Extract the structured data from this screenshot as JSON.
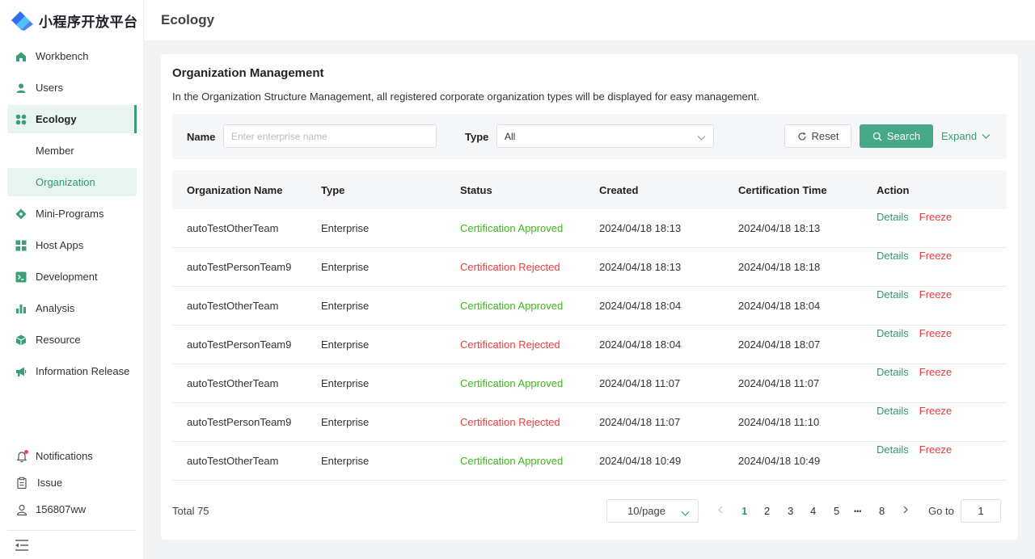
{
  "app": {
    "name": "小程序开放平台"
  },
  "colors": {
    "brand_blue": "#2e6ff2",
    "accent_green": "#46a985",
    "approved": "#3fb51f",
    "rejected": "#ef3c3c"
  },
  "sidebar": {
    "items": [
      {
        "label": "Workbench",
        "icon": "home-icon"
      },
      {
        "label": "Users",
        "icon": "user-icon"
      },
      {
        "label": "Ecology",
        "icon": "grid-icon",
        "active": true
      },
      {
        "label": "Member",
        "sub": true
      },
      {
        "label": "Organization",
        "sub": true,
        "active": true
      },
      {
        "label": "Mini-Programs",
        "icon": "diamond-icon"
      },
      {
        "label": "Host Apps",
        "icon": "apps-icon"
      },
      {
        "label": "Development",
        "icon": "terminal-icon"
      },
      {
        "label": "Analysis",
        "icon": "bar-chart-icon"
      },
      {
        "label": "Resource",
        "icon": "cube-icon"
      },
      {
        "label": "Information Release",
        "icon": "megaphone-icon"
      }
    ],
    "bottom": [
      {
        "label": "Notifications",
        "icon": "bell-icon",
        "has_dot": true
      },
      {
        "label": "Issue",
        "icon": "clipboard-icon"
      },
      {
        "label": "156807ww",
        "icon": "profile-icon"
      }
    ]
  },
  "header": {
    "title": "Ecology"
  },
  "card": {
    "title": "Organization Management",
    "description": "In the Organization Structure Management, all registered corporate organization types will be displayed for easy management."
  },
  "filter": {
    "name_label": "Name",
    "name_placeholder": "Enter enterprise name",
    "name_value": "",
    "type_label": "Type",
    "type_value": "All",
    "reset_label": "Reset",
    "search_label": "Search",
    "expand_label": "Expand"
  },
  "table": {
    "columns": [
      "Organization Name",
      "Type",
      "Status",
      "Created",
      "Certification Time",
      "Action"
    ],
    "rows": [
      {
        "name": "autoTestOtherTeam",
        "type": "Enterprise",
        "status": "Certification Approved",
        "status_kind": "approved",
        "created": "2024/04/18 18:13",
        "cert_time": "2024/04/18 18:13",
        "details": "Details",
        "freeze": "Freeze"
      },
      {
        "name": "autoTestPersonTeam9",
        "type": "Enterprise",
        "status": "Certification Rejected",
        "status_kind": "rejected",
        "created": "2024/04/18 18:13",
        "cert_time": "2024/04/18 18:18",
        "details": "Details",
        "freeze": "Freeze"
      },
      {
        "name": "autoTestOtherTeam",
        "type": "Enterprise",
        "status": "Certification Approved",
        "status_kind": "approved",
        "created": "2024/04/18 18:04",
        "cert_time": "2024/04/18 18:04",
        "details": "Details",
        "freeze": "Freeze"
      },
      {
        "name": "autoTestPersonTeam9",
        "type": "Enterprise",
        "status": "Certification Rejected",
        "status_kind": "rejected",
        "created": "2024/04/18 18:04",
        "cert_time": "2024/04/18 18:07",
        "details": "Details",
        "freeze": "Freeze"
      },
      {
        "name": "autoTestOtherTeam",
        "type": "Enterprise",
        "status": "Certification Approved",
        "status_kind": "approved",
        "created": "2024/04/18 11:07",
        "cert_time": "2024/04/18 11:07",
        "details": "Details",
        "freeze": "Freeze"
      },
      {
        "name": "autoTestPersonTeam9",
        "type": "Enterprise",
        "status": "Certification Rejected",
        "status_kind": "rejected",
        "created": "2024/04/18 11:07",
        "cert_time": "2024/04/18 11:10",
        "details": "Details",
        "freeze": "Freeze"
      },
      {
        "name": "autoTestOtherTeam",
        "type": "Enterprise",
        "status": "Certification Approved",
        "status_kind": "approved",
        "created": "2024/04/18 10:49",
        "cert_time": "2024/04/18 10:49",
        "details": "Details",
        "freeze": "Freeze"
      }
    ]
  },
  "pagination": {
    "total": "Total 75",
    "page_size": "10/page",
    "pages": [
      "1",
      "2",
      "3",
      "4",
      "5",
      "•••",
      "8"
    ],
    "current_page": "1",
    "goto_label": "Go to",
    "goto_value": "1"
  }
}
